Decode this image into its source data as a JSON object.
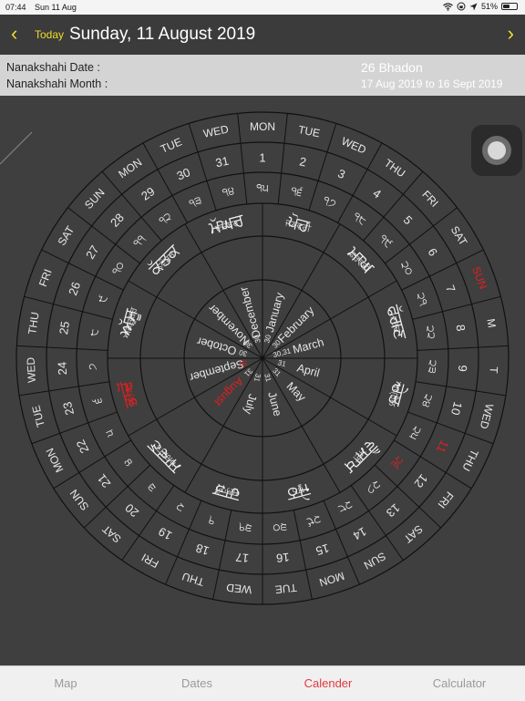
{
  "status": {
    "time": "07:44",
    "date": "Sun 11 Aug",
    "battery": "51%",
    "icons": [
      "wifi-icon",
      "lock-rotation-icon",
      "location-icon",
      "battery-icon"
    ]
  },
  "nav": {
    "back_icon": "‹",
    "today": "Today",
    "title": "Sunday, 11 August 2019",
    "forward_icon": "›"
  },
  "info": {
    "date_label": "Nanakshahi  Date :",
    "month_label": "Nanakshahi Month :",
    "date_value": "26 Bhadon",
    "month_value": "17 Aug 2019 to  16 Sept 2019"
  },
  "colors": {
    "accent": "#f1dd2a",
    "red": "#e02020",
    "tab_active": "#e03a3f"
  },
  "tabs": [
    {
      "label": "Map"
    },
    {
      "label": "Dates"
    },
    {
      "label": "Calender"
    },
    {
      "label": "Calculator"
    }
  ],
  "dial": {
    "outer_weekdays": [
      "MON",
      "TUE",
      "WED",
      "THU",
      "FRI",
      "SAT",
      "SUN",
      "M",
      "T",
      "WED",
      "THU",
      "FRI",
      "SAT",
      "SUN",
      "MON",
      "TUE",
      "WED",
      "THU",
      "FRI",
      "SAT",
      "SUN",
      "MON",
      "TUE",
      "WED",
      "THU",
      "FRI",
      "SAT",
      "SUN",
      "MON",
      "TUE",
      "WED"
    ],
    "outer_highlight_index": 6,
    "dates": [
      "1",
      "2",
      "3",
      "4",
      "5",
      "6",
      "7",
      "8",
      "9",
      "10",
      "11",
      "12",
      "13",
      "14",
      "15",
      "16",
      "17",
      "18",
      "19",
      "20",
      "21",
      "22",
      "23",
      "24",
      "25",
      "26",
      "27",
      "28",
      "29",
      "30",
      "31"
    ],
    "date_highlight_index": 10,
    "gurmukhi_numerals": [
      "੧੫",
      "੧੬",
      "੧੭",
      "੧੮",
      "੧੯",
      "੨੦",
      "੨੧",
      "੨੨",
      "੨੩",
      "੨੪",
      "੨੫",
      "੨੬",
      "੨੭",
      "੨੮",
      "੨੯",
      "੩੦",
      "੩੧",
      "੧",
      "੨",
      "੩",
      "੪",
      "੫",
      "੬",
      "੭",
      "੮",
      "੯",
      "੧੦",
      "੧੧",
      "੧੨",
      "੧੩",
      "੧੪"
    ],
    "gurmukhi_highlight_index": 11,
    "nanakshahi_months": [
      "ਪੋਹ",
      "ਮਾਘ",
      "ਫੱਗਣ",
      "ਚੇਤ",
      "ਵੈਸਾਖ",
      "ਜੇਠ",
      "ਹਾੜ",
      "ਸਾਵਣ",
      "ਭਾਦੋਂ",
      "ਅੱਸੂ",
      "ਕੱਤਕ",
      "ਮੱਘਰ"
    ],
    "nanakshahi_highlight_index": 8,
    "punjabi_months": [
      "ਜਨਵਰੀ",
      "ਫਰਵਰੀ",
      "ਮਾਰਚ",
      "ਅਪ੍ਰੈਲ",
      "ਮਈ",
      "ਜੂਨ",
      "ਜੁਲਾਈ",
      "ਅਗਸਤ",
      "ਸਤੰਬਰ",
      "ਅਕਤੂਬਰ",
      "ਨਵੰਬਰ",
      "ਦਸੰਬਰ"
    ],
    "punjabi_highlight_index": 8,
    "english_months": [
      "January",
      "February",
      "March",
      "April",
      "May",
      "June",
      "July",
      "August",
      "September",
      "October",
      "November",
      "December"
    ],
    "english_highlight_index": 7,
    "month_lengths": [
      "30",
      "30",
      "30,31",
      "31",
      "31",
      "31",
      "31",
      "31",
      "30",
      "30",
      "30",
      "30"
    ],
    "month_length_highlight_index": 8
  }
}
